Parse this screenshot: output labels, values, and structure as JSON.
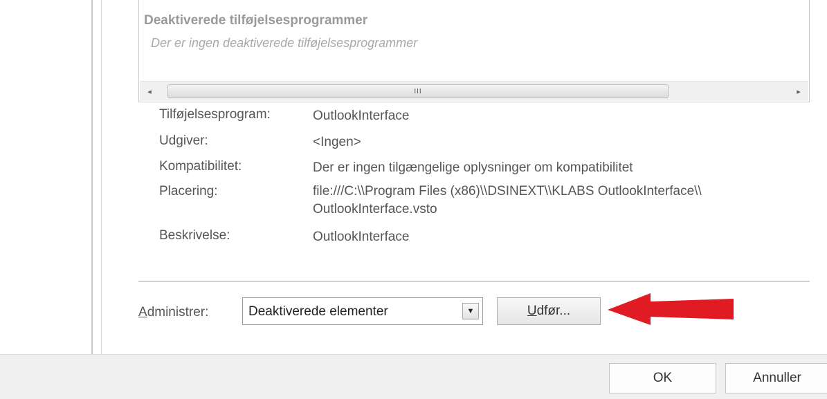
{
  "list": {
    "group_header": "Deaktiverede tilføjelsesprogrammer",
    "group_empty_text": "Der er ingen deaktiverede tilføjelsesprogrammer",
    "scrollbar": {
      "left_arrow": "◂",
      "right_arrow": "▸",
      "grip": "III"
    }
  },
  "details": {
    "addin_label": "Tilføjelsesprogram:",
    "addin_value": "OutlookInterface",
    "publisher_label": "Udgiver:",
    "publisher_value": "<Ingen>",
    "compat_label": "Kompatibilitet:",
    "compat_value": "Der er ingen tilgængelige oplysninger om kompatibilitet",
    "location_label": "Placering:",
    "location_value_line1": "file:///C:\\\\Program Files (x86)\\\\DSINEXT\\\\KLABS OutlookInterface\\\\",
    "location_value_line2": "OutlookInterface.vsto",
    "description_label": "Beskrivelse:",
    "description_value": "OutlookInterface"
  },
  "manage": {
    "label_accel": "A",
    "label_rest": "dministrer:",
    "selected_value": "Deaktiverede elementer",
    "dropdown_arrow": "▼",
    "go_accel": "U",
    "go_rest": "dfør..."
  },
  "footer": {
    "ok_label": "OK",
    "cancel_label": "Annuller"
  },
  "colors": {
    "annotation_arrow": "#e01b24"
  }
}
